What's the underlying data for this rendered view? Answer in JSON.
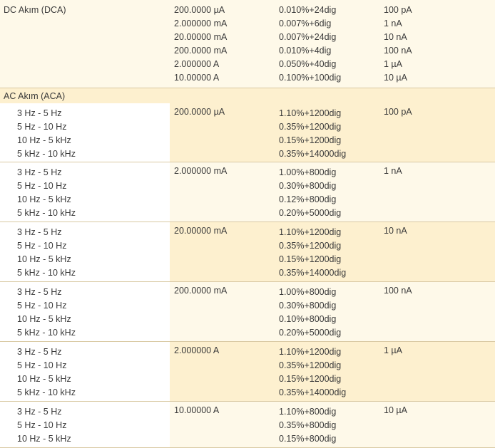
{
  "dc": {
    "label": "DC Akım (DCA)",
    "ranges": [
      "200.0000 µA",
      "2.000000 mA",
      "20.00000 mA",
      "200.0000 mA",
      "2.000000 A",
      "10.00000 A"
    ],
    "accuracy": [
      "0.010%+24dig",
      "0.007%+6dig",
      "0.007%+24dig",
      "0.010%+4dig",
      "0.050%+40dig",
      "0.100%+100dig"
    ],
    "resolution": [
      "100 pA",
      "1 nA",
      "10 nA",
      "100 nA",
      "1 µA",
      "10 µA"
    ]
  },
  "ac": {
    "label": "AC Akım (ACA)",
    "groups": [
      {
        "freqs": [
          "3 Hz - 5 Hz",
          "5 Hz - 10 Hz",
          "10 Hz - 5 kHz",
          "5 kHz - 10 kHz"
        ],
        "range": "200.0000 µA",
        "accuracy": [
          "1.10%+1200dig",
          "0.35%+1200dig",
          "0.15%+1200dig",
          "0.35%+14000dig"
        ],
        "resolution": "100 pA"
      },
      {
        "freqs": [
          "3 Hz - 5 Hz",
          "5 Hz - 10 Hz",
          "10 Hz - 5 kHz",
          "5 kHz - 10 kHz"
        ],
        "range": "2.000000 mA",
        "accuracy": [
          "1.00%+800dig",
          "0.30%+800dig",
          "0.12%+800dig",
          "0.20%+5000dig"
        ],
        "resolution": "1 nA"
      },
      {
        "freqs": [
          "3 Hz - 5 Hz",
          "5 Hz - 10 Hz",
          "10 Hz - 5 kHz",
          "5 kHz - 10 kHz"
        ],
        "range": "20.00000 mA",
        "accuracy": [
          "1.10%+1200dig",
          "0.35%+1200dig",
          "0.15%+1200dig",
          "0.35%+14000dig"
        ],
        "resolution": "10 nA"
      },
      {
        "freqs": [
          "3 Hz - 5 Hz",
          "5 Hz - 10 Hz",
          "10 Hz - 5 kHz",
          "5 kHz - 10 kHz"
        ],
        "range": "200.0000 mA",
        "accuracy": [
          "1.00%+800dig",
          "0.30%+800dig",
          "0.10%+800dig",
          "0.20%+5000dig"
        ],
        "resolution": "100 nA"
      },
      {
        "freqs": [
          "3 Hz - 5 Hz",
          "5 Hz - 10 Hz",
          "10 Hz - 5 kHz",
          "5 kHz - 10 kHz"
        ],
        "range": "2.000000 A",
        "accuracy": [
          "1.10%+1200dig",
          "0.35%+1200dig",
          "0.15%+1200dig",
          "0.35%+14000dig"
        ],
        "resolution": "1 µA"
      },
      {
        "freqs": [
          "3 Hz - 5 Hz",
          "5 Hz - 10 Hz",
          "10 Hz - 5 kHz"
        ],
        "range": "10.00000 A",
        "accuracy": [
          "1.10%+800dig",
          "0.35%+800dig",
          "0.15%+800dig"
        ],
        "resolution": "10 µA"
      }
    ]
  },
  "colors": {
    "row_light": "#fef9e9",
    "row_dark": "#fdf0cf",
    "freq_cell": "#ffffff",
    "border": "#d9c9a3",
    "text": "#3a3a3a"
  }
}
